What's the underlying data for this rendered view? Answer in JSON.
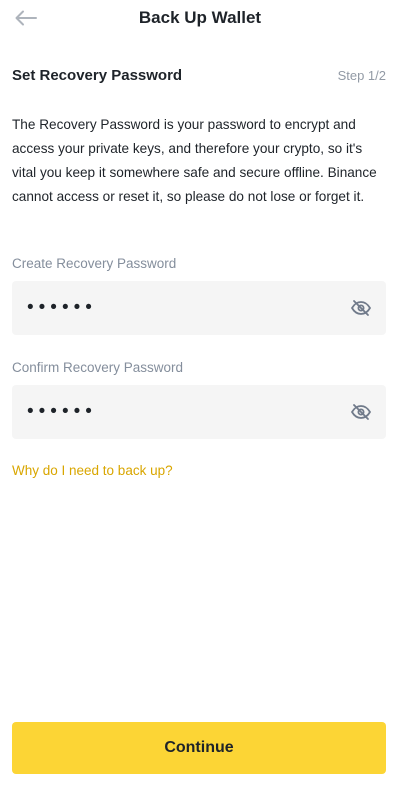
{
  "header": {
    "title": "Back Up Wallet",
    "back_icon": "arrow-left-icon"
  },
  "section": {
    "title": "Set Recovery Password",
    "step": "Step 1/2"
  },
  "description": "The Recovery Password is your password to encrypt and access your private keys, and therefore your crypto, so it's vital you keep it somewhere safe and secure offline. Binance cannot access or reset it, so please do not lose or forget it.",
  "create_field": {
    "label": "Create Recovery Password",
    "masked_value": "••••••",
    "toggle_icon": "eye-slash-icon"
  },
  "confirm_field": {
    "label": "Confirm Recovery Password",
    "masked_value": "••••••",
    "toggle_icon": "eye-slash-icon"
  },
  "help_link": "Why do I need to back up?",
  "continue_label": "Continue",
  "colors": {
    "accent": "#fcd535",
    "link": "#d9a600",
    "field_bg": "#f5f5f5",
    "muted_text": "#848e9c"
  }
}
